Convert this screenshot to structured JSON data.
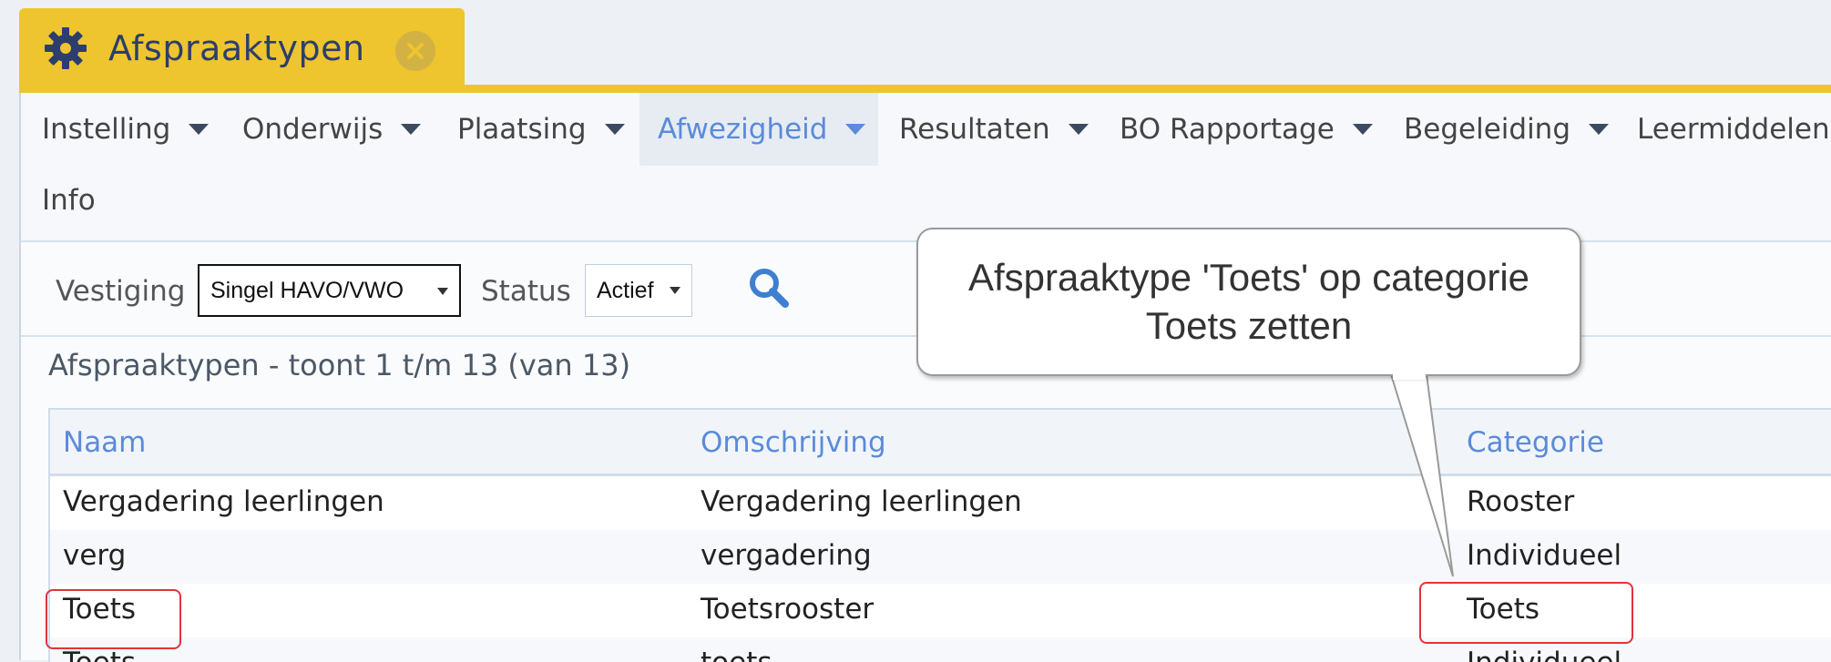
{
  "tab": {
    "title": "Afspraaktypen",
    "icon": "gear-icon",
    "close_icon": "close-circle-icon"
  },
  "colors": {
    "accent_yellow": "#eec52f",
    "link_blue": "#5b8bd9",
    "highlight_red": "#e2333b"
  },
  "menu": {
    "items": [
      {
        "label": "Instelling",
        "has_dropdown": true
      },
      {
        "label": "Onderwijs",
        "has_dropdown": true
      },
      {
        "label": "Plaatsing",
        "has_dropdown": true
      },
      {
        "label": "Afwezigheid",
        "has_dropdown": true,
        "active": true
      },
      {
        "label": "Resultaten",
        "has_dropdown": true
      },
      {
        "label": "BO Rapportage",
        "has_dropdown": true
      },
      {
        "label": "Begeleiding",
        "has_dropdown": true
      },
      {
        "label": "Leermiddelen",
        "has_dropdown": false
      }
    ],
    "second_row": [
      {
        "label": "Info"
      }
    ]
  },
  "filter": {
    "vestiging_label": "Vestiging",
    "vestiging_value": "Singel HAVO/VWO",
    "status_label": "Status",
    "status_value": "Actief",
    "search_icon": "search-icon"
  },
  "list": {
    "title": "Afspraaktypen - toont 1 t/m 13 (van 13)",
    "columns": [
      "Naam",
      "Omschrijving",
      "Categorie"
    ],
    "rows": [
      {
        "naam": "Vergadering leerlingen",
        "omschrijving": "Vergadering leerlingen",
        "categorie": "Rooster"
      },
      {
        "naam": "verg",
        "omschrijving": "vergadering",
        "categorie": "Individueel"
      },
      {
        "naam": "Toets",
        "omschrijving": "Toetsrooster",
        "categorie": "Toets"
      },
      {
        "naam": "Toets",
        "omschrijving": "toets",
        "categorie": "Individueel"
      }
    ]
  },
  "callout": {
    "text": "Afspraaktype 'Toets' op categorie Toets  zetten"
  }
}
